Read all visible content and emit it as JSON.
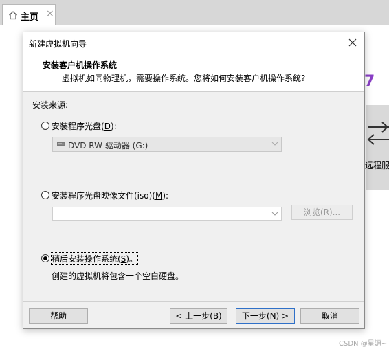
{
  "app": {
    "tab_title": "主页",
    "tab_close": "×",
    "remote_label": "远程服",
    "accent_text": "7",
    "watermark": "CSDN @星源~"
  },
  "dialog": {
    "title": "新建虚拟机向导",
    "heading": "安装客户机操作系统",
    "subheading": "虚拟机如同物理机，需要操作系统。您将如何安装客户机操作系统?",
    "source_label": "安装来源:",
    "options": [
      {
        "label_pre": "安装程序光盘(",
        "key": "D",
        "label_post": "):",
        "selected": false
      },
      {
        "label_pre": "安装程序光盘映像文件(iso)(",
        "key": "M",
        "label_post": "):",
        "selected": false
      },
      {
        "label_pre": "稍后安装操作系统(",
        "key": "S",
        "label_post": ")。",
        "selected": true
      }
    ],
    "disc_drive_value": "DVD RW 驱动器 (G:)",
    "iso_path_value": "",
    "browse_button": "浏览(R)...",
    "later_description": "创建的虚拟机将包含一个空白硬盘。",
    "buttons": {
      "help": "帮助",
      "back": "< 上一步(B)",
      "next": "下一步(N) >",
      "cancel": "取消"
    }
  },
  "colors": {
    "accent_purple": "#8a3fc6",
    "default_button_border": "#2f70c8"
  }
}
